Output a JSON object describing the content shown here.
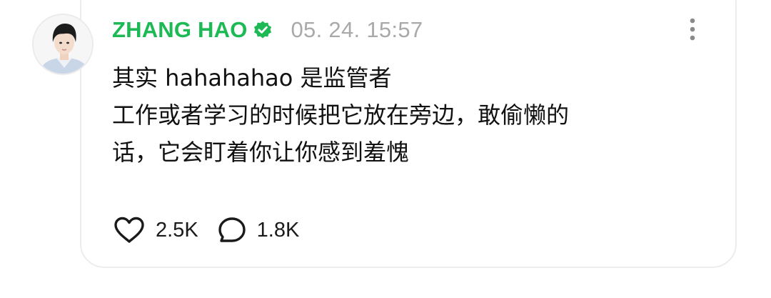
{
  "post": {
    "author": "ZHANG HAO",
    "verified_icon": "verified-badge-icon",
    "timestamp": "05. 24. 15:57",
    "lines": [
      "其实 hahahahao 是监管者",
      "工作或者学习的时候把它放在旁边，敢偷懒的",
      "话，它会盯着你让你感到羞愧"
    ],
    "likes": "2.5K",
    "comments": "1.8K"
  },
  "icons": {
    "more": "more-vertical-icon",
    "like": "heart-icon",
    "comment": "comment-bubble-icon"
  },
  "colors": {
    "author": "#1db954",
    "verified": "#1db954",
    "timestamp": "#a9a9a9",
    "text": "#111111",
    "card_border": "#ececec"
  }
}
